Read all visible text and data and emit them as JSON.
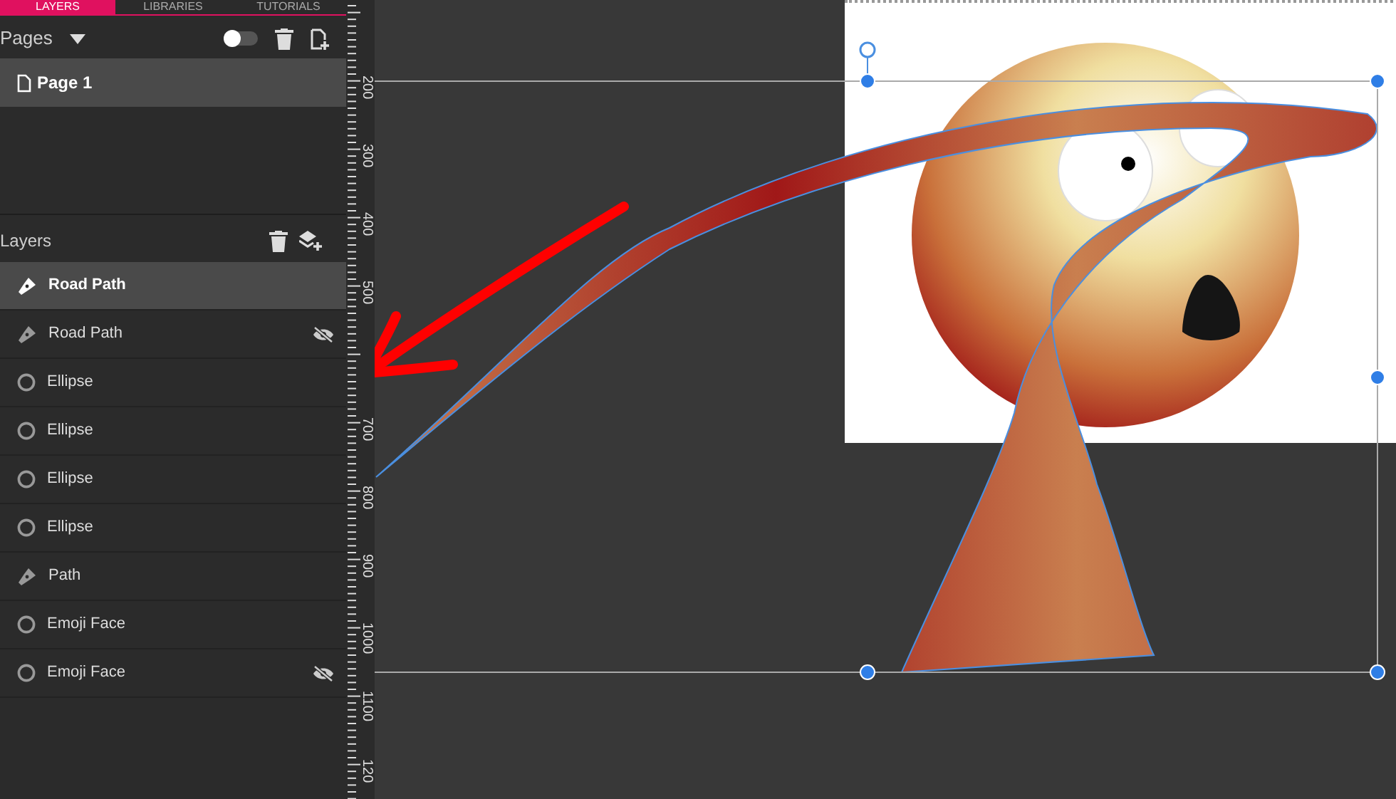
{
  "tabs": [
    {
      "label": "LAYERS",
      "selected": true
    },
    {
      "label": "LIBRARIES",
      "selected": false
    },
    {
      "label": "TUTORIALS",
      "selected": false
    }
  ],
  "pages": {
    "title": "Pages",
    "toggle_on": false,
    "items": [
      {
        "label": "Page 1",
        "selected": true
      }
    ]
  },
  "layers": {
    "title": "Layers",
    "items": [
      {
        "label": "Road Path",
        "kind": "pen",
        "selected": true,
        "hidden": false
      },
      {
        "label": "Road Path",
        "kind": "pen",
        "selected": false,
        "hidden": true
      },
      {
        "label": "Ellipse",
        "kind": "ellipse",
        "selected": false,
        "hidden": false
      },
      {
        "label": "Ellipse",
        "kind": "ellipse",
        "selected": false,
        "hidden": false
      },
      {
        "label": "Ellipse",
        "kind": "ellipse",
        "selected": false,
        "hidden": false
      },
      {
        "label": "Ellipse",
        "kind": "ellipse",
        "selected": false,
        "hidden": false
      },
      {
        "label": "Path",
        "kind": "pen",
        "selected": false,
        "hidden": false
      },
      {
        "label": "Emoji Face",
        "kind": "ellipse",
        "selected": false,
        "hidden": false
      },
      {
        "label": "Emoji Face",
        "kind": "ellipse",
        "selected": false,
        "hidden": true
      }
    ]
  },
  "ruler": {
    "labels": [
      "200",
      "300",
      "400",
      "500",
      "700",
      "800",
      "900",
      "1000",
      "1100",
      "120"
    ]
  }
}
